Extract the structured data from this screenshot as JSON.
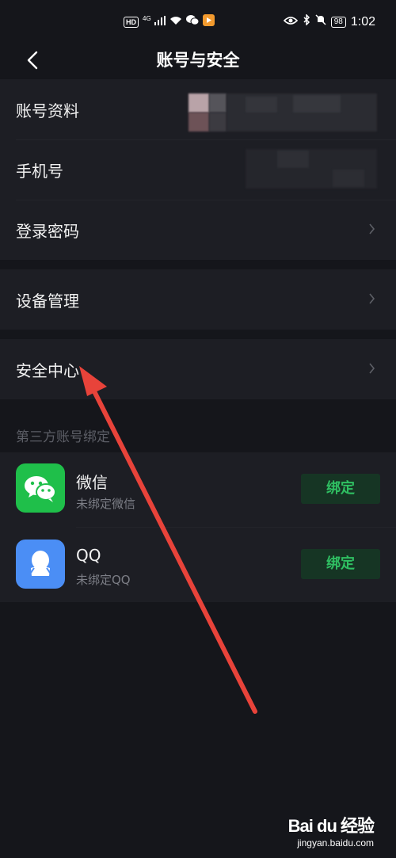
{
  "status_bar": {
    "hd": "HD",
    "network": "4G",
    "battery": "98",
    "time": "1:02"
  },
  "nav": {
    "title": "账号与安全"
  },
  "account_rows": [
    {
      "label": "账号资料"
    },
    {
      "label": "手机号"
    },
    {
      "label": "登录密码"
    }
  ],
  "device_row": {
    "label": "设备管理"
  },
  "security_row": {
    "label": "安全中心"
  },
  "third_party": {
    "title": "第三方账号绑定",
    "items": [
      {
        "name": "微信",
        "status": "未绑定微信",
        "button": "绑定"
      },
      {
        "name": "QQ",
        "status": "未绑定QQ",
        "button": "绑定"
      }
    ]
  },
  "watermark": {
    "logo": "Bai du 经验",
    "url": "jingyan.baidu.com"
  },
  "colors": {
    "background": "#15161b",
    "card": "#1d1e24",
    "bind_text": "#2fbf62",
    "bind_bg": "#163524",
    "wechat": "#1fbf4a",
    "qq": "#4b8ef5",
    "annotation_arrow": "#e8433a"
  },
  "icons": {
    "back": "chevron-left-icon",
    "row_arrow": "chevron-right-icon",
    "wechat": "wechat-icon",
    "qq": "qq-icon"
  }
}
